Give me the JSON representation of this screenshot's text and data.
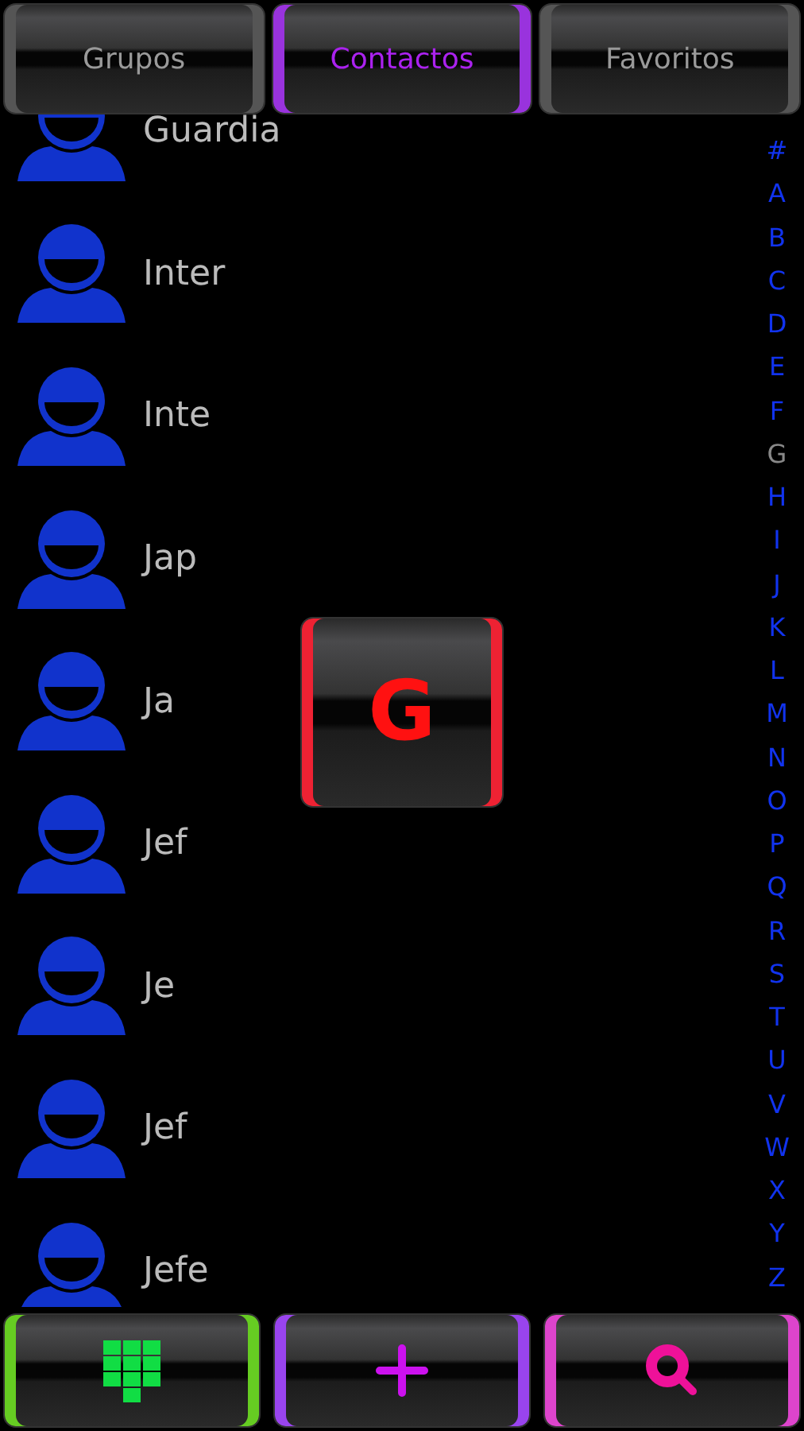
{
  "tabs": [
    {
      "label": "Grupos",
      "selected": false
    },
    {
      "label": "Contactos",
      "selected": true
    },
    {
      "label": "Favoritos",
      "selected": false
    }
  ],
  "contacts": [
    {
      "name": "Guardia"
    },
    {
      "name": "Inter"
    },
    {
      "name": "Inte"
    },
    {
      "name": "Jap"
    },
    {
      "name": "Ja"
    },
    {
      "name": "Jef"
    },
    {
      "name": "Je"
    },
    {
      "name": "Jef"
    },
    {
      "name": "Jefe"
    }
  ],
  "index": [
    {
      "letter": "#",
      "selected": false
    },
    {
      "letter": "A",
      "selected": false
    },
    {
      "letter": "B",
      "selected": false
    },
    {
      "letter": "C",
      "selected": false
    },
    {
      "letter": "D",
      "selected": false
    },
    {
      "letter": "E",
      "selected": false
    },
    {
      "letter": "F",
      "selected": false
    },
    {
      "letter": "G",
      "selected": true
    },
    {
      "letter": "H",
      "selected": false
    },
    {
      "letter": "I",
      "selected": false
    },
    {
      "letter": "J",
      "selected": false
    },
    {
      "letter": "K",
      "selected": false
    },
    {
      "letter": "L",
      "selected": false
    },
    {
      "letter": "M",
      "selected": false
    },
    {
      "letter": "N",
      "selected": false
    },
    {
      "letter": "O",
      "selected": false
    },
    {
      "letter": "P",
      "selected": false
    },
    {
      "letter": "Q",
      "selected": false
    },
    {
      "letter": "R",
      "selected": false
    },
    {
      "letter": "S",
      "selected": false
    },
    {
      "letter": "T",
      "selected": false
    },
    {
      "letter": "U",
      "selected": false
    },
    {
      "letter": "V",
      "selected": false
    },
    {
      "letter": "W",
      "selected": false
    },
    {
      "letter": "X",
      "selected": false
    },
    {
      "letter": "Y",
      "selected": false
    },
    {
      "letter": "Z",
      "selected": false
    }
  ],
  "popup": {
    "letter": "G"
  },
  "actions": [
    {
      "kind": "dialpad",
      "color": "#66cc22"
    },
    {
      "kind": "add",
      "color": "#9944ee"
    },
    {
      "kind": "search",
      "color": "#dd44cc"
    }
  ]
}
